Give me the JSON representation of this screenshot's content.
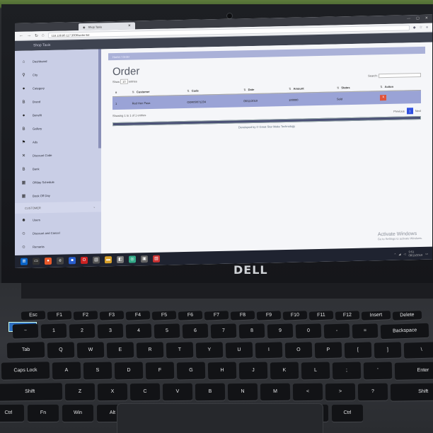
{
  "browser": {
    "tab_title": "Shop Taxis",
    "url": "118.128.80.117:3008/order-list"
  },
  "app": {
    "brand": "Shop Taxis",
    "breadcrumb": "Home / Order",
    "page_title": "Order",
    "show_label": "Show",
    "entries_value": "10",
    "entries_label": "entries",
    "search_label": "Search:"
  },
  "sidebar": {
    "items": [
      {
        "label": "Dashboard",
        "icon": "home-icon"
      },
      {
        "label": "City",
        "icon": "pin-icon"
      },
      {
        "label": "Category",
        "icon": "circle-icon"
      },
      {
        "label": "Brand",
        "icon": "b-icon"
      },
      {
        "label": "Benefit",
        "icon": "circle-icon"
      },
      {
        "label": "Gallery",
        "icon": "b-icon"
      },
      {
        "label": "Ads",
        "icon": "flag-icon"
      },
      {
        "label": "Discount Code",
        "icon": "x-icon"
      },
      {
        "label": "Bank",
        "icon": "b-icon"
      },
      {
        "label": "Offday Schedule",
        "icon": "calendar-icon"
      },
      {
        "label": "Book Off Day",
        "icon": "calendar-icon"
      }
    ],
    "section_label": "CUSTOMER",
    "section_items": [
      {
        "label": "Users",
        "icon": "users-icon"
      },
      {
        "label": "Discount and Cancel",
        "icon": "user-icon"
      },
      {
        "label": "Remarks",
        "icon": "user-icon"
      }
    ]
  },
  "table": {
    "columns": [
      "#",
      "Customer",
      "Code",
      "Date",
      "Amount",
      "Status",
      "Action"
    ],
    "rows": [
      [
        "1",
        "Red Hen Pass",
        "ODR09071234",
        "08/11/2019",
        "100000",
        "Sold",
        "x"
      ]
    ],
    "showing_text": "Showing 1 to 1 of 1 entries",
    "prev_label": "Previous",
    "current_page": "1",
    "next_label": "Next"
  },
  "footer": {
    "developed_by": "Developed by © Great Star Make Technology"
  },
  "windows": {
    "activate_title": "Activate Windows",
    "activate_sub": "Go to Settings to activate Windows.",
    "clock_time": "9:51",
    "clock_date": "08/11/2019"
  },
  "laptop": {
    "brand_logo": "DELL"
  },
  "keyboard": {
    "row1": [
      "Esc",
      "F1",
      "F2",
      "F3",
      "F4",
      "F5",
      "F6",
      "F7",
      "F8",
      "F9",
      "F10",
      "F11",
      "F12",
      "Insert",
      "Delete"
    ],
    "row2": [
      "~",
      "1",
      "2",
      "3",
      "4",
      "5",
      "6",
      "7",
      "8",
      "9",
      "0",
      "-",
      "=",
      "Backspace"
    ],
    "row3": [
      "Tab",
      "Q",
      "W",
      "E",
      "R",
      "T",
      "Y",
      "U",
      "I",
      "O",
      "P",
      "[",
      "]",
      "\\"
    ],
    "row4": [
      "Caps Lock",
      "A",
      "S",
      "D",
      "F",
      "G",
      "H",
      "J",
      "K",
      "L",
      ";",
      "'",
      "Enter"
    ],
    "row5": [
      "Shift",
      "Z",
      "X",
      "C",
      "V",
      "B",
      "N",
      "M",
      "<",
      ">",
      "?",
      "Shift"
    ],
    "row6": [
      "Ctrl",
      "Fn",
      "Win",
      "Alt",
      "",
      "Alt",
      "Ctrl"
    ]
  },
  "colors": {
    "sidebar": "#c9cee6",
    "selected_row": "#9aa3d6",
    "action_button": "#e0533a",
    "pager_active": "#3050e0"
  }
}
